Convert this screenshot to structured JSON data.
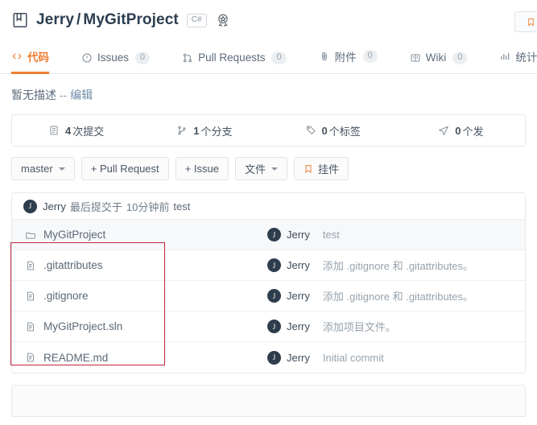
{
  "header": {
    "repo_icon": "repo-book-icon",
    "owner": "Jerry",
    "separator": "/",
    "name": "MyGitProject",
    "language_badge": "C#",
    "award_icon": "award-rosette-icon",
    "right_button_icon": "bookmark-icon"
  },
  "tabs": [
    {
      "label": "代码",
      "icon": "code-icon",
      "count": null,
      "active": true
    },
    {
      "label": "Issues",
      "icon": "issue-circle-icon",
      "count": "0",
      "active": false
    },
    {
      "label": "Pull Requests",
      "icon": "git-pull-request-icon",
      "count": "0",
      "active": false
    },
    {
      "label": "附件",
      "icon": "paperclip-icon",
      "count": "0",
      "active": false
    },
    {
      "label": "Wiki",
      "icon": "book-icon",
      "count": "0",
      "active": false
    },
    {
      "label": "统计",
      "icon": "bar-chart-icon",
      "count": null,
      "active": false
    }
  ],
  "description": {
    "text": "暂无描述",
    "dashes": "--",
    "edit_label": "编辑"
  },
  "stats": [
    {
      "icon": "commit-list-icon",
      "value": "4",
      "label": "次提交"
    },
    {
      "icon": "branch-icon",
      "value": "1",
      "label": "个分支"
    },
    {
      "icon": "tag-icon",
      "value": "0",
      "label": "个标签"
    },
    {
      "icon": "release-send-icon",
      "value": "0",
      "label": "个发"
    }
  ],
  "actions": [
    {
      "label": "master",
      "icon": null,
      "caret": true
    },
    {
      "label": "+ Pull Request",
      "icon": null,
      "caret": false
    },
    {
      "label": "+ Issue",
      "icon": null,
      "caret": false
    },
    {
      "label": "文件",
      "icon": null,
      "caret": true
    },
    {
      "label": "挂件",
      "icon": "bookmark-icon",
      "caret": false
    }
  ],
  "latest_commit": {
    "avatar_initial": "J",
    "user": "Jerry",
    "prefix": "最后提交于",
    "time": "10分钟前",
    "message": "test"
  },
  "files": [
    {
      "icon": "folder-icon",
      "name": "MyGitProject",
      "avatar_initial": "J",
      "user": "Jerry",
      "message": "test",
      "highlighted": true
    },
    {
      "icon": "file-icon",
      "name": ".gitattributes",
      "avatar_initial": "J",
      "user": "Jerry",
      "message": "添加 .gitignore 和 .gitattributes。",
      "highlighted": false
    },
    {
      "icon": "file-icon",
      "name": ".gitignore",
      "avatar_initial": "J",
      "user": "Jerry",
      "message": "添加 .gitignore 和 .gitattributes。",
      "highlighted": false
    },
    {
      "icon": "file-icon",
      "name": "MyGitProject.sln",
      "avatar_initial": "J",
      "user": "Jerry",
      "message": "添加项目文件。",
      "highlighted": false
    },
    {
      "icon": "file-icon",
      "name": "README.md",
      "avatar_initial": "J",
      "user": "Jerry",
      "message": "Initial commit",
      "highlighted": false
    }
  ],
  "annotation": {
    "type": "red-rectangle-highlight",
    "color": "#c0253c"
  },
  "colors": {
    "accent": "#ef7d32",
    "text": "#2c3e50",
    "muted": "#98a3ad",
    "border": "#e6e9ed",
    "annotation": "#c0253c"
  }
}
